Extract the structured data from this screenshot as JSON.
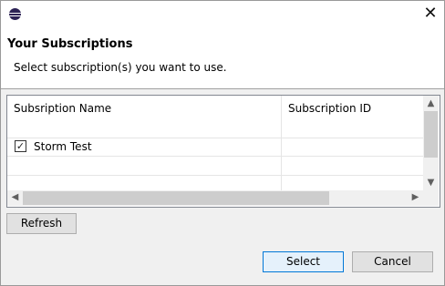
{
  "window": {
    "close_glyph": "✕"
  },
  "header": {
    "title": "Your Subscriptions",
    "message": "Select subscription(s) you want to use."
  },
  "table": {
    "columns": [
      "Subsription Name",
      "Subscription ID"
    ],
    "rows": [
      {
        "checked": true,
        "name": "Storm Test",
        "id": ""
      }
    ]
  },
  "buttons": {
    "refresh": "Refresh",
    "select": "Select",
    "cancel": "Cancel"
  },
  "icons": {
    "app": "eclipse-icon",
    "close": "close-icon",
    "checkbox": "checkbox-checked-icon"
  },
  "colors": {
    "default_button_border": "#0078d7",
    "header_bg": "#ffffff",
    "dialog_bg": "#f0f0f0"
  }
}
